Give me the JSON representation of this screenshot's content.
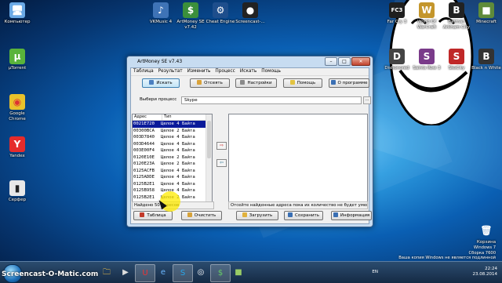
{
  "desktop": {
    "icons_left": [
      {
        "label": "Компьютер",
        "glyph": "🖥",
        "color": "#6aa9e6"
      },
      {
        "label": "µTorrent",
        "glyph": "µ",
        "color": "#59b33b"
      },
      {
        "label": "Google Chrome",
        "glyph": "◉",
        "color": "#e9c22b"
      },
      {
        "label": "Yandex",
        "glyph": "Y",
        "color": "#e52b2b"
      },
      {
        "label": "Серфер",
        "glyph": "▮",
        "color": "#2a2a2a"
      }
    ],
    "icons_top": [
      {
        "label": "VKMusic 4",
        "glyph": "♪",
        "color": "#3e73b6"
      },
      {
        "label": "ArtMoney SE v7.42",
        "glyph": "$",
        "color": "#3b8f3b"
      },
      {
        "label": "Cheat Engine",
        "glyph": "⚙",
        "color": "#1e4e8c"
      },
      {
        "label": "Screencast-...",
        "glyph": "●",
        "color": "#222222"
      }
    ],
    "icons_right": [
      {
        "label": "Far Cry 3",
        "glyph": "FC3",
        "color": "#1f1f1f"
      },
      {
        "label": "World Of WarCraft",
        "glyph": "W",
        "color": "#c4962c"
      },
      {
        "label": "Batman Arkham City",
        "glyph": "B",
        "color": "#222222"
      },
      {
        "label": "Minecraft",
        "glyph": "■",
        "color": "#5f8b3a"
      },
      {
        "label": "Dishonored",
        "glyph": "D",
        "color": "#444444"
      },
      {
        "label": "Saints Row 3",
        "glyph": "S",
        "color": "#7a3b8a"
      },
      {
        "label": "SkoCity",
        "glyph": "S",
        "color": "#c02828"
      },
      {
        "label": "Black n White",
        "glyph": "B",
        "color": "#333333"
      }
    ],
    "recycle_bin": {
      "label": "Корзина",
      "glyph": "🗑"
    }
  },
  "window": {
    "title": "ArtMoney SE v7.43",
    "menu": [
      "Таблица",
      "Результат",
      "Изменить",
      "Процесс",
      "Искать",
      "Помощь"
    ],
    "toolbar": {
      "search": "Искать",
      "filter": "Отсеять",
      "settings": "Настройки",
      "help": "Помощь",
      "about": "О программе"
    },
    "process_label": "Выбери процесс",
    "process_value": "Skype",
    "process_button": "...",
    "list_headers": {
      "address": "Адрес",
      "type": "Тип"
    },
    "rows": [
      {
        "addr": "0021E720",
        "type": "Целое 4 Байта"
      },
      {
        "addr": "00300BCA",
        "type": "Целое 2 Байта"
      },
      {
        "addr": "003D7840",
        "type": "Целое 4 Байта"
      },
      {
        "addr": "003D4644",
        "type": "Целое 4 Байта"
      },
      {
        "addr": "003E00F4",
        "type": "Целое 4 Байта"
      },
      {
        "addr": "0120E10E",
        "type": "Целое 2 Байта"
      },
      {
        "addr": "0120E23A",
        "type": "Целое 2 Байта"
      },
      {
        "addr": "0125ACFB",
        "type": "Целое 4 Байта"
      },
      {
        "addr": "0125ADDE",
        "type": "Целое 4 Байта"
      },
      {
        "addr": "0125B2E1",
        "type": "Целое 4 Байта"
      },
      {
        "addr": "0125B958",
        "type": "Целое 4 Байта"
      },
      {
        "addr": "0125B2E1",
        "type": "Целое 2 Байта"
      }
    ],
    "arrow_left": "⇦",
    "arrow_right": "⇨",
    "status_left": "Найдено 50 адресов",
    "status_right": "Отсейте найденные адреса пока их количество не будет уменьш...",
    "bottom": {
      "table": "Таблица",
      "clear": "Очистить",
      "load": "Загрузить",
      "save": "Сохранить",
      "info": "Информация"
    }
  },
  "taskbar": {
    "watermark": "Screencast-O-Matic.com",
    "items": [
      "🗀",
      "▶",
      "U",
      "e",
      "S",
      "◎",
      "$",
      "■"
    ],
    "lang": "EN",
    "time": "22:24",
    "date": "23.08.2014"
  },
  "wininfo": {
    "line1": "Windows 7",
    "line2": "Сборка 7600",
    "line3": "Ваша копия Windows не является подлинной"
  },
  "colors": {
    "selection": "#0b1a9a",
    "client_bg": "#f0f0f0"
  }
}
